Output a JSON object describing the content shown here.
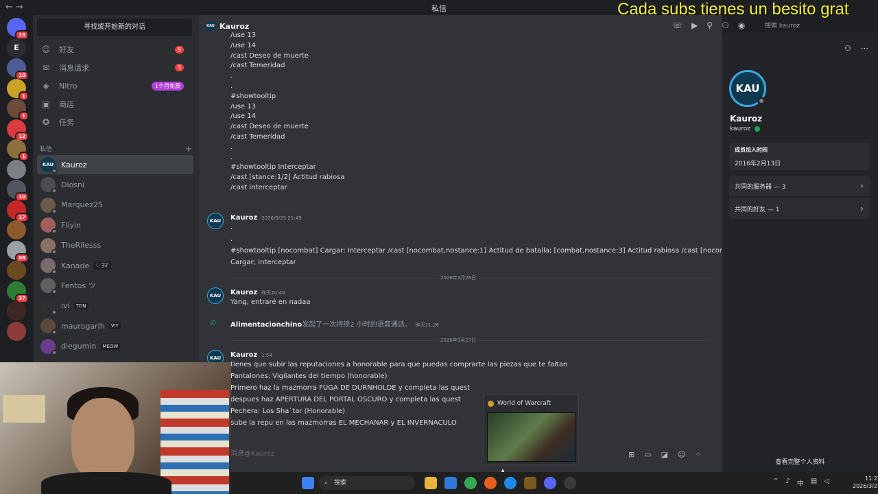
{
  "window": {
    "nav": "← →",
    "title": "私信"
  },
  "overlay": "Cada subs tienes un besito grat",
  "guilds": [
    {
      "label": "",
      "badge": "13",
      "color": "#5865f2"
    },
    {
      "label": "E",
      "badge": "",
      "color": "#2b2d31"
    },
    {
      "label": "",
      "badge": "10",
      "color": "#4e5d94"
    },
    {
      "label": "",
      "badge": "1",
      "color": "#c9a227"
    },
    {
      "label": "",
      "badge": "1",
      "color": "#6b4a3a"
    },
    {
      "label": "",
      "badge": "12",
      "color": "#d83c3e"
    },
    {
      "label": "",
      "badge": "1",
      "color": "#8c6f3a"
    },
    {
      "label": "",
      "badge": "",
      "color": "#7b7f86"
    },
    {
      "label": "",
      "badge": "10",
      "color": "#4f5660"
    },
    {
      "label": "",
      "badge": "17",
      "color": "#c62828"
    },
    {
      "label": "",
      "badge": "",
      "color": "#8d5a2b"
    },
    {
      "label": "",
      "badge": "68",
      "color": "#9aa0a6"
    },
    {
      "label": "",
      "badge": "",
      "color": "#6a4a20"
    },
    {
      "label": "",
      "badge": "37",
      "color": "#2e7d32"
    },
    {
      "label": "",
      "badge": "",
      "color": "#3e2723"
    },
    {
      "label": "",
      "badge": "",
      "color": "#8e3b3b"
    }
  ],
  "dm_sidebar": {
    "search": "寻找或开始新的对话",
    "nav": [
      {
        "label": "好友",
        "icon": "friends-icon",
        "glyph": "☺",
        "badge": "9"
      },
      {
        "label": "消息请求",
        "icon": "mail-icon",
        "glyph": "✉",
        "badge": "3"
      },
      {
        "label": "Nitro",
        "icon": "nitro-icon",
        "glyph": "◈",
        "badge": "1个月免费"
      },
      {
        "label": "商店",
        "icon": "shop-icon",
        "glyph": "▣",
        "badge": ""
      },
      {
        "label": "任务",
        "icon": "quest-icon",
        "glyph": "✪",
        "badge": ""
      }
    ],
    "section": "私信",
    "section_plus": "+",
    "dms": [
      {
        "name": "Kauroz",
        "tag": "",
        "avatar": "KAU",
        "active": true
      },
      {
        "name": "Diosni",
        "tag": ""
      },
      {
        "name": "Marquez25",
        "tag": ""
      },
      {
        "name": "Fliyin",
        "tag": ""
      },
      {
        "name": "TheRilesss",
        "tag": ""
      },
      {
        "name": "Kanade",
        "tag": "♡ ਤੇਰਾ"
      },
      {
        "name": "Fentos ツ",
        "tag": ""
      },
      {
        "name": "ivi",
        "tag": "TDN"
      },
      {
        "name": "maurogarih",
        "tag": "VIT"
      },
      {
        "name": "diegumin",
        "tag": "MEOW"
      }
    ]
  },
  "chat": {
    "name": "Kauroz",
    "avatar": "KAU",
    "search_placeholder": "搜索 kauroz",
    "lines_top": [
      "/use 13",
      "/use 14",
      "/cast Deseo de muerte",
      "/cast Temeridad",
      ".",
      ".",
      "#showtooltip",
      "/use 13",
      "/use 14",
      "/cast Deseo de muerte",
      "/cast Temeridad",
      ".",
      ".",
      "#showtooltip Interceptar",
      "/cast [stance:1/2] Actitud rabiosa",
      "/cast Interceptar"
    ],
    "msg2": {
      "author": "Kauroz",
      "time": "2026/3/25 21:49",
      "lines": [
        ".",
        ".",
        "#showtooltip [nocombat] Cargar; Interceptar /cast [nocombat,nostance:1] Actitud de batalla; [combat,nostance:3] Actitud rabiosa /cast [nocombat]",
        "Cargar; Interceptar"
      ]
    },
    "divider1": "2026年3月26日",
    "msg3": {
      "author": "Kauroz",
      "time": "昨天20:48",
      "lines": [
        "Yang, entraré en nadaa"
      ]
    },
    "call": {
      "caller": "Alimentacionchino",
      "text": "发起了一次持续2 小时的语音通话。",
      "time": "昨天21:26"
    },
    "divider2": "2026年3月27日",
    "msg4": {
      "author": "Kauroz",
      "time": "1:54",
      "lines": [
        "tienes que subir las reputaciones a honorable para que puedas comprarte las piezas que te faltan",
        "Pantalones: Vigilantes del tiempo (honorable)",
        "Primero haz la mazmorra  FUGA DE DURNHOLDE y completa las quest",
        "despues haz APERTURA DEL PORTAL OSCURO y completa las quest",
        "Pechera:  Los Sha`tar  (Honorable)",
        "sube la repu en las mazmorras EL MECHANAR y EL INVERNACULO"
      ]
    },
    "composer_placeholder": "消息@Kauroz"
  },
  "profile": {
    "avatar": "KAU",
    "display_name": "Kauroz",
    "username": "kauroz",
    "member_since_label": "成员加入时间",
    "member_since": "2016年2月13日",
    "mutual_servers": "共同的服务器 — 3",
    "mutual_friends": "共同的好友 — 1",
    "full_profile": "查看完整个人资料"
  },
  "popup": {
    "title": "World of Warcraft"
  },
  "taskbar": {
    "search": "搜索",
    "time": "11:21",
    "date": "2026/3/27",
    "ime": "中"
  }
}
